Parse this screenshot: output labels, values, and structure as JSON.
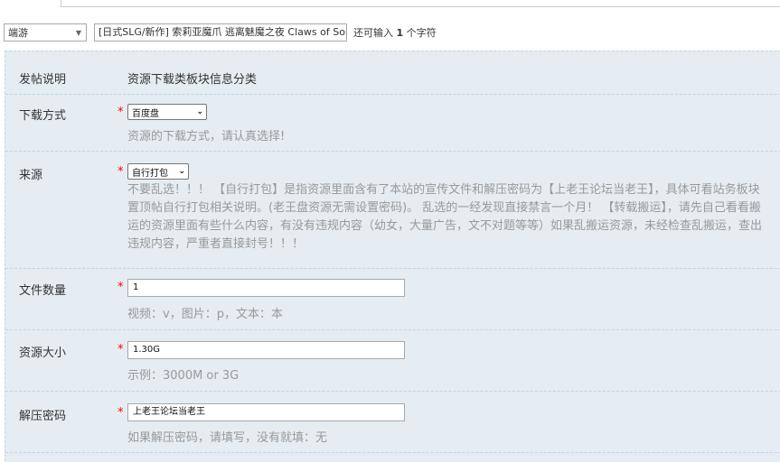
{
  "header": {
    "type_select": "端游",
    "subject": "[日式SLG/新作] 索莉亚魔爪 逃离魅魔之夜 Claws of Soria",
    "counter_prefix": "还可输入",
    "counter_num": "1",
    "counter_suffix": "个字符"
  },
  "form": {
    "intro": {
      "label": "发帖说明",
      "text": "资源下载类板块信息分类"
    },
    "download": {
      "label": "下载方式",
      "star": "*",
      "value": "百度盘",
      "hint": "资源的下载方式，请认真选择!"
    },
    "source": {
      "label": "来源",
      "star": "*",
      "value": "自行打包",
      "lines": [
        "不要乱选！！！ 【自行打包】是指资源里面含有了本站的宣传文件和解压密码为【上老王论坛当老王】，具体可看站务板块",
        "置顶帖自行打包相关说明。(老王盘资源无需设置密码)。 乱选的一经发现直接禁言一个月！ 【转载搬运】，请先自己看看搬",
        "运的资源里面有些什么内容，有没有违规内容（幼女，大量广告，文不对题等等）如果乱搬运资源，未经检查乱搬运，查出",
        "违规内容，严重者直接封号！！！"
      ]
    },
    "file_count": {
      "label": "文件数量",
      "star": "*",
      "value": "1",
      "hint": "视频：v，图片：p，文本：本"
    },
    "size": {
      "label": "资源大小",
      "star": "*",
      "value": "1.30G",
      "hint": "示例：3000M or 3G"
    },
    "password": {
      "label": "解压密码",
      "star": "*",
      "value": "上老王论坛当老王",
      "hint": "如果解压密码，请填写，没有就填：无"
    }
  }
}
